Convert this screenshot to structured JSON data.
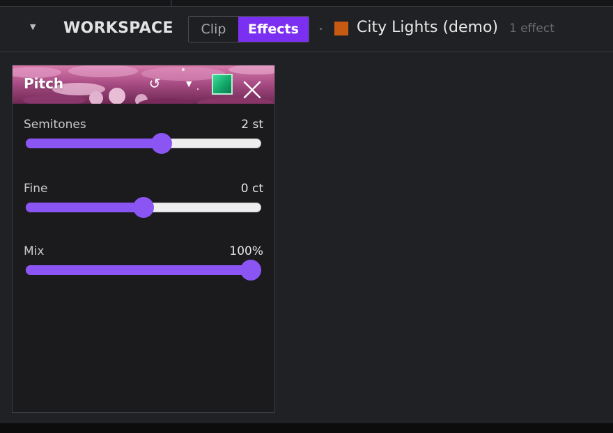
{
  "header": {
    "title": "WORKSPACE",
    "tabs": [
      {
        "label": "Clip",
        "active": false
      },
      {
        "label": "Effects",
        "active": true
      }
    ],
    "clip_name": "City Lights (demo)",
    "clip_color": "#c65a12",
    "effect_count": "1 effect"
  },
  "colors": {
    "accent": "#7b2ff0",
    "slider": "#8a55f2",
    "effect_chip": "#12a86a"
  },
  "effect": {
    "name": "Pitch",
    "reset_icon": "reset-icon",
    "close_icon": "close-icon",
    "params": [
      {
        "label": "Semitones",
        "value_text": "2 st",
        "level": 0.58
      },
      {
        "label": "Fine",
        "value_text": "0 ct",
        "level": 0.5
      },
      {
        "label": "Mix",
        "value_text": "100%",
        "level": 1.0
      }
    ]
  }
}
